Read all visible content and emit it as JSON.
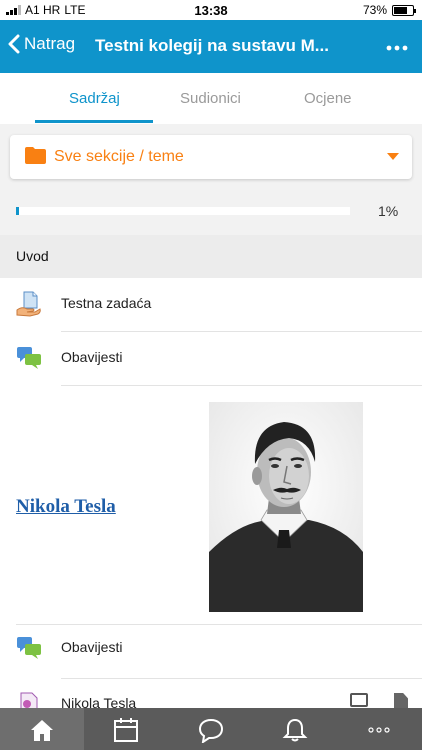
{
  "status_bar": {
    "carrier": "A1 HR",
    "network": "LTE",
    "time": "13:38",
    "battery": "73%",
    "battery_level": 0.73
  },
  "nav": {
    "back_label": "Natrag",
    "title": "Testni kolegij na sustavu M...",
    "more_icon": "more-icon"
  },
  "tabs": [
    {
      "label": "Sadržaj",
      "active": true
    },
    {
      "label": "Sudionici",
      "active": false
    },
    {
      "label": "Ocjene",
      "active": false
    }
  ],
  "section_selector": {
    "label": "Sve sekcije / teme",
    "icon": "folder-icon"
  },
  "progress": {
    "value": 0.01,
    "label": "1%"
  },
  "section": {
    "title": "Uvod"
  },
  "items": [
    {
      "label": "Testna zadaća",
      "icon": "assignment-icon"
    },
    {
      "label": "Obavijesti",
      "icon": "forum-icon"
    },
    {
      "label": "Obavijesti",
      "icon": "forum-icon"
    },
    {
      "label": "Nikola Tesla",
      "icon": "file-icon"
    }
  ],
  "label_block": {
    "link_text": "Nikola Tesla",
    "image_icon": "portrait-image"
  },
  "bottom_tabs": [
    {
      "name": "home-icon",
      "active": true
    },
    {
      "name": "calendar-icon",
      "active": false
    },
    {
      "name": "messages-icon",
      "active": false
    },
    {
      "name": "notifications-icon",
      "active": false
    },
    {
      "name": "more-icon",
      "active": false
    }
  ],
  "colors": {
    "brand": "#0f94cb",
    "accent": "#f98012",
    "tabbar": "#5b5b5b"
  }
}
